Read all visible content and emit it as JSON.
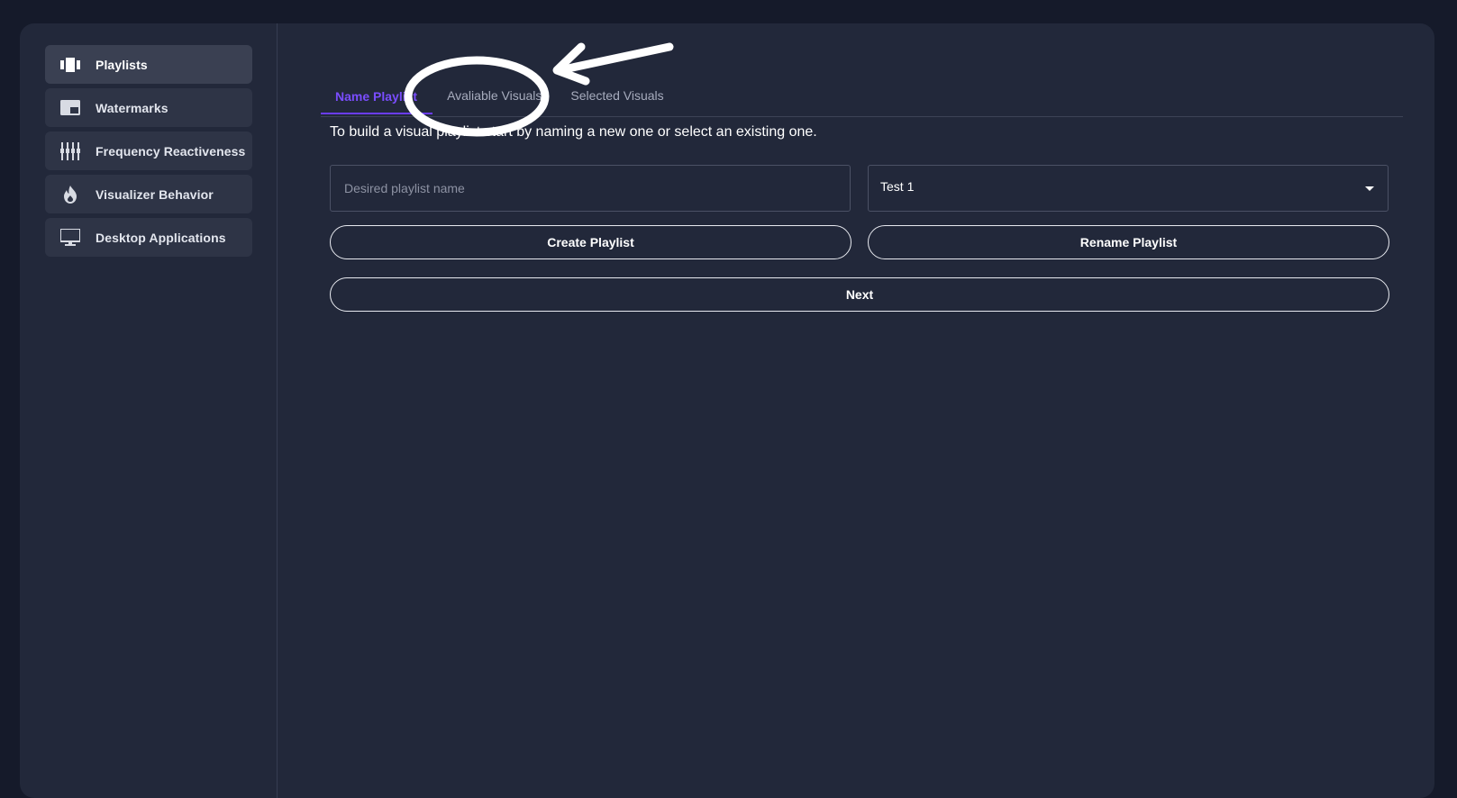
{
  "sidebar": {
    "items": [
      {
        "label": "Playlists",
        "icon": "playlists-icon",
        "active": true
      },
      {
        "label": "Watermarks",
        "icon": "watermark-icon",
        "active": false
      },
      {
        "label": "Frequency Reactiveness",
        "icon": "equalizer-icon",
        "active": false
      },
      {
        "label": "Visualizer Behavior",
        "icon": "flame-icon",
        "active": false
      },
      {
        "label": "Desktop Applications",
        "icon": "monitor-icon",
        "active": false
      }
    ]
  },
  "main": {
    "tabs": [
      {
        "label": "Name Playlist",
        "active": true
      },
      {
        "label": "Avaliable Visuals",
        "active": false
      },
      {
        "label": "Selected Visuals",
        "active": false
      }
    ],
    "intro": "To build a visual playlist start by naming a new one or select an existing one.",
    "name_input": {
      "value": "",
      "placeholder": "Desired playlist name"
    },
    "playlist_select": {
      "selected": "Test 1"
    },
    "buttons": {
      "create": "Create Playlist",
      "rename": "Rename Playlist",
      "next": "Next"
    }
  },
  "colors": {
    "background": "#151a2a",
    "panel": "#22283a",
    "nav_item": "#2e3446",
    "accent": "#7a4dff"
  }
}
